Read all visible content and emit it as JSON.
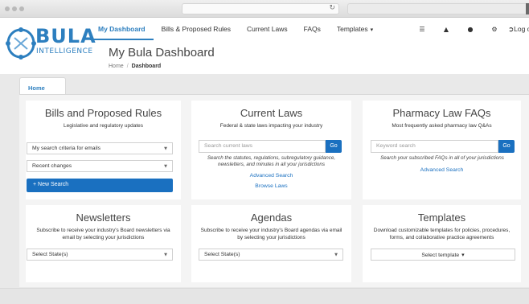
{
  "app": {
    "logo_main": "BULA",
    "logo_sub": "INTELLIGENCE"
  },
  "nav": {
    "items": [
      {
        "label": "My Dashboard"
      },
      {
        "label": "Bills & Proposed Rules"
      },
      {
        "label": "Current Laws"
      },
      {
        "label": "FAQs"
      },
      {
        "label": "Templates"
      }
    ],
    "logout": "Log o"
  },
  "page": {
    "title": "My Bula Dashboard",
    "breadcrumb": {
      "home": "Home",
      "current": "Dashboard"
    }
  },
  "tabs": {
    "home": "Home"
  },
  "cards": {
    "bills": {
      "title": "Bills and Proposed Rules",
      "subtitle": "Legislative and regulatory updates",
      "select1": "My search criteria for emails",
      "select2": "Recent changes",
      "button": "+ New Search"
    },
    "laws": {
      "title": "Current Laws",
      "subtitle": "Federal & state laws impacting your industry",
      "placeholder": "Search current laws",
      "go": "Go",
      "hint": "Search the statutes, regulations, subregulatory guidance, newsletters, and minutes in all your jurisdictions",
      "advanced": "Advanced Search",
      "browse": "Browse Laws"
    },
    "faqs": {
      "title": "Pharmacy Law FAQs",
      "subtitle": "Most frequently asked pharmacy law Q&As",
      "placeholder": "Keyword search",
      "go": "Go",
      "hint": "Search your subscribed FAQs in all of your jurisdictions",
      "advanced": "Advanced Search"
    },
    "newsletters": {
      "title": "Newsletters",
      "subtitle": "Subscribe to receive your industry's Board newsletters via email by selecting your jurisdictions",
      "select": "Select State(s)"
    },
    "agendas": {
      "title": "Agendas",
      "subtitle": "Subscribe to receive your industry's Board agendas via email by selecting your jurisdictions",
      "select": "Select State(s)"
    },
    "templates": {
      "title": "Templates",
      "subtitle": "Download customizable templates for policies, procedures, forms, and collaborative practice agreements",
      "button": "Select template"
    }
  },
  "colors": {
    "accent": "#2d7fbf",
    "button": "#1a70c0"
  }
}
